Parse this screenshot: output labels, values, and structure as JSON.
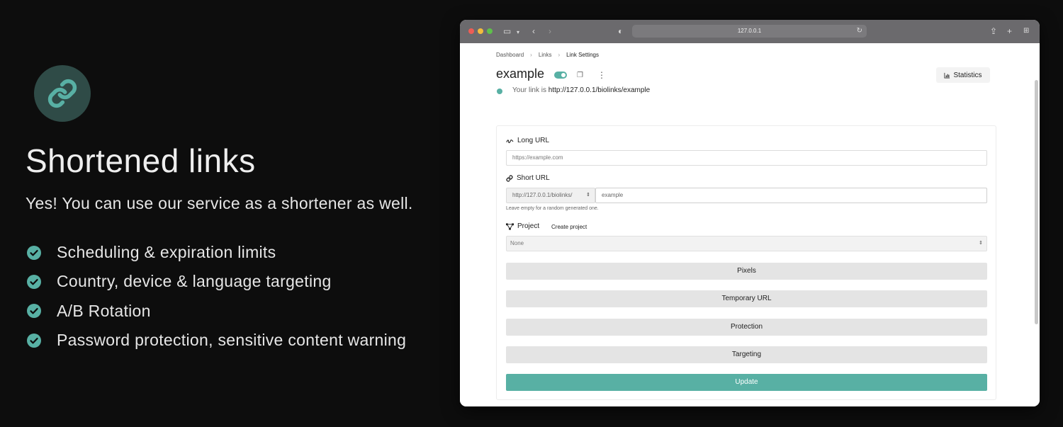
{
  "promo": {
    "logo_icon": "link-icon",
    "title": "Shortened links",
    "subtitle": "Yes! You can use our service as a shortener as well.",
    "features": [
      "Scheduling & expiration limits",
      "Country, device & language targeting",
      "A/B Rotation",
      "Password protection, sensitive content warning"
    ]
  },
  "browser": {
    "address": "127.0.0.1"
  },
  "page": {
    "breadcrumb": [
      "Dashboard",
      "Links",
      "Link Settings"
    ],
    "title": "example",
    "enabled": true,
    "statistics_label": "Statistics",
    "link_prefix_text": "Your link is",
    "link_url": "http://127.0.0.1/biolinks/example"
  },
  "form": {
    "long_url_label": "Long URL",
    "long_url_placeholder": "https://example.com",
    "short_url_label": "Short URL",
    "short_url_prefix": "http://127.0.0.1/biolinks/",
    "short_url_value": "example",
    "short_url_help": "Leave empty for a random generated one.",
    "project_label": "Project",
    "create_project_label": "Create project",
    "project_value": "None",
    "pixels_label": "Pixels",
    "temporary_url_label": "Temporary URL",
    "protection_label": "Protection",
    "targeting_label": "Targeting",
    "update_label": "Update"
  },
  "colors": {
    "accent": "#58b0a4",
    "logo_bg": "#2f4b47",
    "page_bg": "#0d0d0d"
  }
}
